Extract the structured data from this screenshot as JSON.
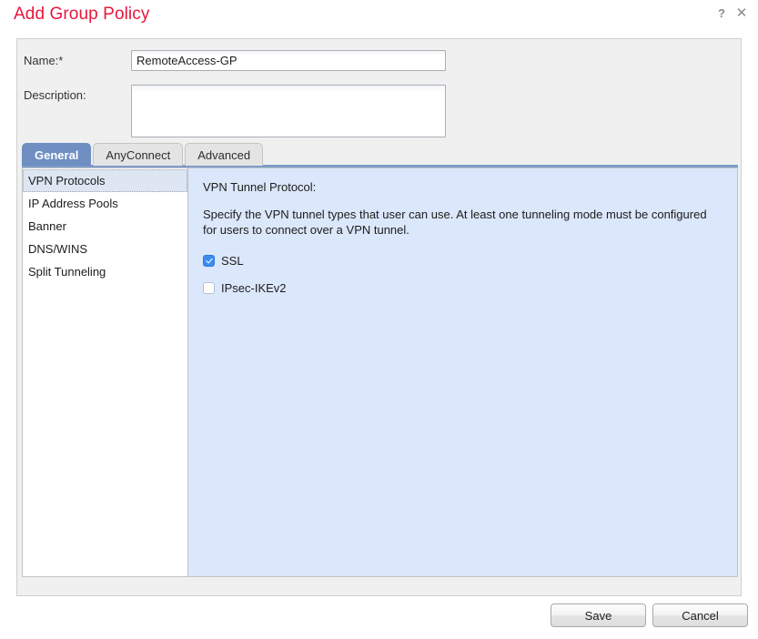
{
  "dialog": {
    "title": "Add Group Policy",
    "help_icon": "question-mark-icon",
    "close_icon": "close-icon"
  },
  "form": {
    "name_label": "Name:*",
    "name_value": "RemoteAccess-GP",
    "name_placeholder": "",
    "description_label": "Description:",
    "description_value": "",
    "description_placeholder": ""
  },
  "tabs": [
    {
      "label": "General",
      "active": true
    },
    {
      "label": "AnyConnect",
      "active": false
    },
    {
      "label": "Advanced",
      "active": false
    }
  ],
  "sidebar": {
    "items": [
      {
        "label": "VPN Protocols",
        "selected": true
      },
      {
        "label": "IP Address Pools",
        "selected": false
      },
      {
        "label": "Banner",
        "selected": false
      },
      {
        "label": "DNS/WINS",
        "selected": false
      },
      {
        "label": "Split Tunneling",
        "selected": false
      }
    ]
  },
  "content": {
    "heading": "VPN Tunnel Protocol:",
    "description": "Specify the VPN tunnel types that user can use. At least one tunneling mode must be configured for users to connect over a VPN tunnel.",
    "checkboxes": [
      {
        "label": "SSL",
        "checked": true
      },
      {
        "label": "IPsec-IKEv2",
        "checked": false
      }
    ]
  },
  "footer": {
    "save_label": "Save",
    "cancel_label": "Cancel"
  },
  "colors": {
    "title_red": "#e8173d",
    "tab_active_blue": "#6f8fc2",
    "tab_underline_blue": "#7c9cc9",
    "content_panel_blue": "#dbe7fa",
    "checkbox_checked_blue": "#3c8cf0",
    "sidebar_selected_blue": "#dde6f2",
    "form_background_gray": "#f0f0f0"
  }
}
